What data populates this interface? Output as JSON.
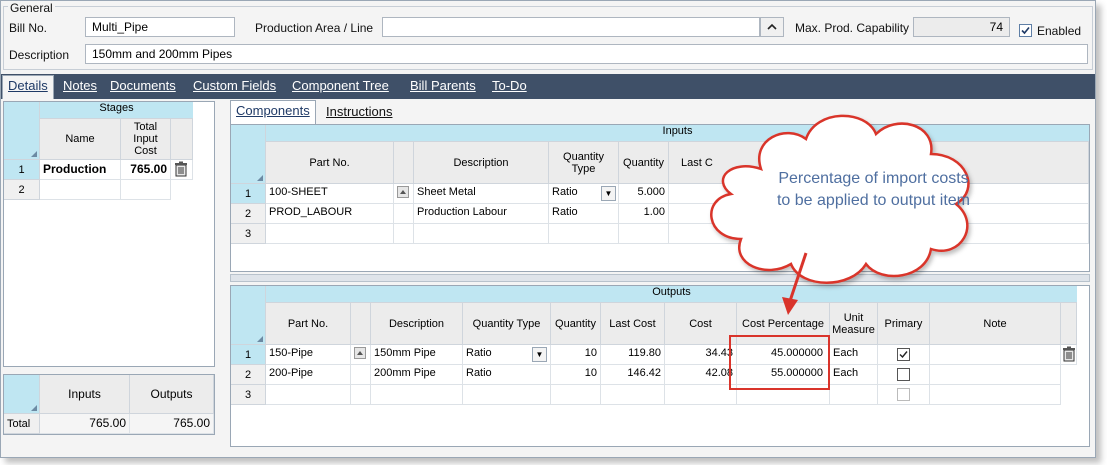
{
  "general": {
    "group_title": "General",
    "bill_no_label": "Bill No.",
    "bill_no_value": "Multi_Pipe",
    "production_area_label": "Production Area / Line",
    "production_area_value": "",
    "max_prod_label": "Max. Prod. Capability",
    "max_prod_value": "74",
    "enabled_label": "Enabled",
    "enabled_checked": true,
    "description_label": "Description",
    "description_value": "150mm and 200mm Pipes"
  },
  "tabs": [
    "Details",
    "Notes",
    "Documents",
    "Custom Fields",
    "Component Tree",
    "Bill Parents",
    "To-Do"
  ],
  "sub_tabs": [
    "Components",
    "Instructions"
  ],
  "stages": {
    "band": "Stages",
    "col_name": "Name",
    "col_cost": "Total Input Cost",
    "rows": [
      {
        "num": "1",
        "name": "Production",
        "cost": "765.00"
      },
      {
        "num": "2",
        "name": "",
        "cost": ""
      }
    ]
  },
  "totals": {
    "col_inputs": "Inputs",
    "col_outputs": "Outputs",
    "row_label": "Total",
    "inputs": "765.00",
    "outputs": "765.00"
  },
  "inputs": {
    "band": "Inputs",
    "headers": [
      "Part No.",
      "Description",
      "Quantity Type",
      "Quantity",
      "Last C"
    ],
    "rows": [
      {
        "num": "1",
        "part": "100-SHEET",
        "desc": "Sheet Metal",
        "qtype": "Ratio",
        "qty": "5.000"
      },
      {
        "num": "2",
        "part": "PROD_LABOUR",
        "desc": "Production Labour",
        "qtype": "Ratio",
        "qty": "1.00"
      },
      {
        "num": "3",
        "part": "",
        "desc": "",
        "qtype": "",
        "qty": ""
      }
    ]
  },
  "outputs": {
    "band": "Outputs",
    "headers": [
      "Part No.",
      "Description",
      "Quantity Type",
      "Quantity",
      "Last Cost",
      "Cost",
      "Cost Percentage",
      "Unit Measure",
      "Primary",
      "Note"
    ],
    "rows": [
      {
        "num": "1",
        "part": "150-Pipe",
        "desc": "150mm Pipe",
        "qtype": "Ratio",
        "qty": "10",
        "last_cost": "119.80",
        "cost": "34.43",
        "pct": "45.000000",
        "unit": "Each",
        "primary": true
      },
      {
        "num": "2",
        "part": "200-Pipe",
        "desc": "200mm Pipe",
        "qtype": "Ratio",
        "qty": "10",
        "last_cost": "146.42",
        "cost": "42.08",
        "pct": "55.000000",
        "unit": "Each",
        "primary": false
      },
      {
        "num": "3",
        "part": "",
        "desc": "",
        "qtype": "",
        "qty": "",
        "last_cost": "",
        "cost": "",
        "pct": "",
        "unit": "",
        "primary": false
      }
    ]
  },
  "callout": {
    "text_line1": "Percentage of import costs",
    "text_line2": "to be applied to output item",
    "accent": "#d9342b"
  }
}
